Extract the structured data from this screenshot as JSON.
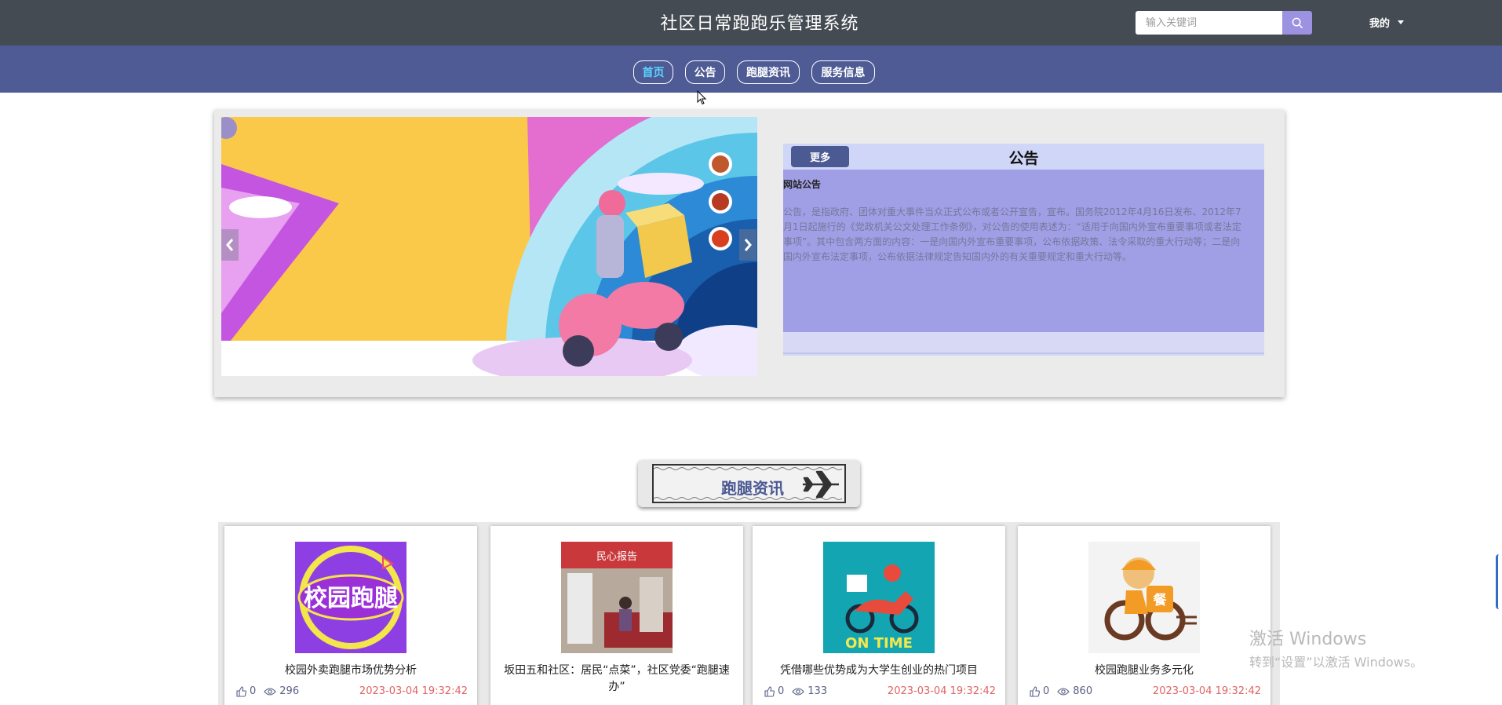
{
  "header": {
    "title": "社区日常跑跑乐管理系统",
    "search_placeholder": "输入关键词",
    "search_icon": "search-icon",
    "user_menu_label": "我的"
  },
  "nav": {
    "items": [
      {
        "label": "首页",
        "active": true
      },
      {
        "label": "公告",
        "active": false
      },
      {
        "label": "跑腿资讯",
        "active": false
      },
      {
        "label": "服务信息",
        "active": false
      }
    ]
  },
  "announcement": {
    "more_label": "更多",
    "title": "公告",
    "subtitle": "网站公告",
    "body": "公告，是指政府、团体对重大事件当众正式公布或者公开宣告，宣布。国务院2012年4月16日发布、2012年7月1日起施行的《党政机关公文处理工作条例》，对公告的使用表述为：“适用于向国内外宣布重要事项或者法定事项”。其中包含两方面的内容：一是向国内外宣布重要事项，公布依据政策、法令采取的重大行动等；二是向国内外宣布法定事项，公布依据法律规定告知国内外的有关重要规定和重大行动等。"
  },
  "news_section": {
    "title": "跑腿资讯",
    "items": [
      {
        "title": "校园外卖跑腿市场优势分析",
        "likes": "0",
        "views": "296",
        "date": "2023-03-04 19:32:42",
        "thumb_text": "校园跑腿"
      },
      {
        "title": "坂田五和社区：居民“点菜”，社区党委“跑腿速办”",
        "likes": "0",
        "views": "133",
        "date": "2023-03-04 19:32:42",
        "thumb_text": "民心报告"
      },
      {
        "title": "凭借哪些优势成为大学生创业的热门项目",
        "likes": "0",
        "views": "133",
        "date": "2023-03-04 19:32:42",
        "thumb_text": "ON TIME"
      },
      {
        "title": "校园跑腿业务多元化",
        "likes": "0",
        "views": "860",
        "date": "2023-03-04 19:32:42",
        "thumb_text": "餐"
      }
    ]
  },
  "watermark": {
    "line1": "激活 Windows",
    "line2": "转到“设置”以激活 Windows。"
  },
  "colors": {
    "topbar": "#454b52",
    "navbar": "#4e5b95",
    "active_nav": "#5bd5ff",
    "accent": "#9c92e2",
    "date": "#e06363"
  }
}
